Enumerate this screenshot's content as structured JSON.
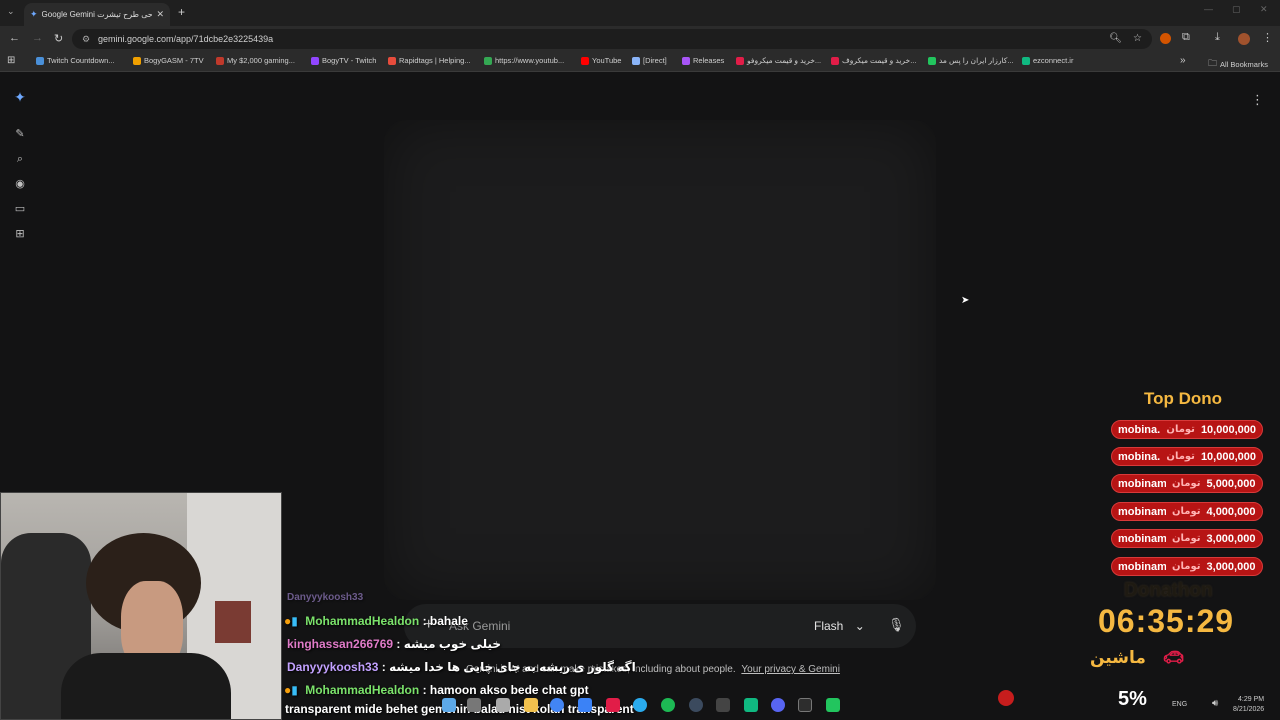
{
  "browser": {
    "tab_title": "Google Gemini طراحی طرح تیشرت",
    "new_tab": "+",
    "url": "gemini.google.com/app/71dcbe2e3225439a",
    "bookmarks": [
      {
        "label": "Twitch Countdown...",
        "color": "#4a90d9"
      },
      {
        "label": "BogyGASM - 7TV",
        "color": "#f0a000"
      },
      {
        "label": "My $2,000 gaming...",
        "color": "#c0392b"
      },
      {
        "label": "BogyTV - Twitch",
        "color": "#9146ff"
      },
      {
        "label": "Rapidtags | Helping...",
        "color": "#e74c3c"
      },
      {
        "label": "https://www.youtub...",
        "color": "#34a853"
      },
      {
        "label": "YouTube",
        "color": "#ff0000"
      },
      {
        "label": "[Direct]",
        "color": "#8ab4f8"
      },
      {
        "label": "Releases",
        "color": "#a855f7"
      },
      {
        "label": "خرید و قیمت میکروفو...",
        "color": "#e11d48"
      },
      {
        "label": "خرید و قیمت میکروف...",
        "color": "#e11d48"
      },
      {
        "label": "کارزار ایران را پس مد...",
        "color": "#22c55e"
      },
      {
        "label": "ezconnect.ir",
        "color": "#10b981"
      }
    ],
    "all_bookmarks": "All Bookmarks"
  },
  "gemini": {
    "prompt_placeholder": "Ask Gemini",
    "model": "Flash",
    "disclaimer": "Gemini is AI and can make mistakes, including about people.",
    "privacy_link": "Your privacy & Gemini"
  },
  "chat": [
    {
      "user": "Danyyykoosh33",
      "text": "",
      "color": "#c2a1ff"
    },
    {
      "user": "MohammadHealdon",
      "text": ": bahale",
      "color": "#7be26b"
    },
    {
      "user": "kinghassan266769",
      "text": ": خیلی خوب میشه",
      "color": "#e07bc8"
    },
    {
      "user": "Danyyykoosh33",
      "text": ": اگه گلوز ی ریشه به جای چایی ها خدا میشه",
      "color": "#c2a1ff"
    },
    {
      "user": "MohammadHealdon",
      "text": ": hamoon akso bede chat gpt",
      "color": "#7be26b"
    },
    {
      "user": "",
      "text": "transparent mide behet gemenin balad nist kolan transparent",
      "color": "#ffffff"
    }
  ],
  "donations": {
    "title": "Top Dono",
    "currency": "تومان",
    "rows": [
      {
        "name": "mobina...",
        "amount": "10,000,000"
      },
      {
        "name": "mobina...",
        "amount": "10,000,000"
      },
      {
        "name": "mobinam...",
        "amount": "5,000,000"
      },
      {
        "name": "mobinam...",
        "amount": "4,000,000"
      },
      {
        "name": "mobinam...",
        "amount": "3,000,000"
      },
      {
        "name": "mobinam...",
        "amount": "3,000,000"
      }
    ],
    "event_name": "Donathon",
    "timer": "06:35:29",
    "car_label": "ماشین",
    "progress_text": "5%"
  },
  "taskbar": {
    "lang": "ENG",
    "time": "4:29 PM",
    "date": "8/21/2026"
  }
}
